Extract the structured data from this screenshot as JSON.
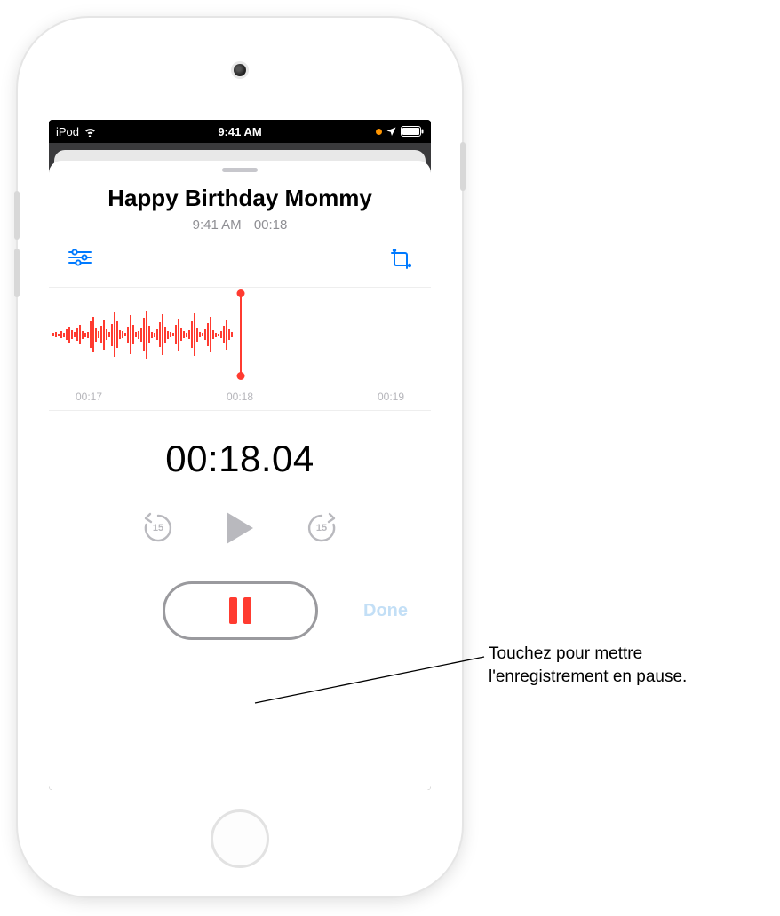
{
  "status": {
    "carrier": "iPod",
    "time": "9:41 AM"
  },
  "recording": {
    "title": "Happy Birthday Mommy",
    "timestamp": "9:41 AM",
    "duration": "00:18",
    "elapsed": "00:18.04",
    "ticks": {
      "left": "00:17",
      "center": "00:18",
      "right": "00:19"
    }
  },
  "transport": {
    "skip_back": "15",
    "skip_fwd": "15"
  },
  "buttons": {
    "done": "Done"
  },
  "callout": {
    "text": "Touchez pour mettre l'enregistrement en pause."
  },
  "colors": {
    "accent_red": "#ff3b30",
    "accent_blue": "#007aff",
    "dim_gray": "#b9b9be",
    "orange": "#ff9500"
  }
}
